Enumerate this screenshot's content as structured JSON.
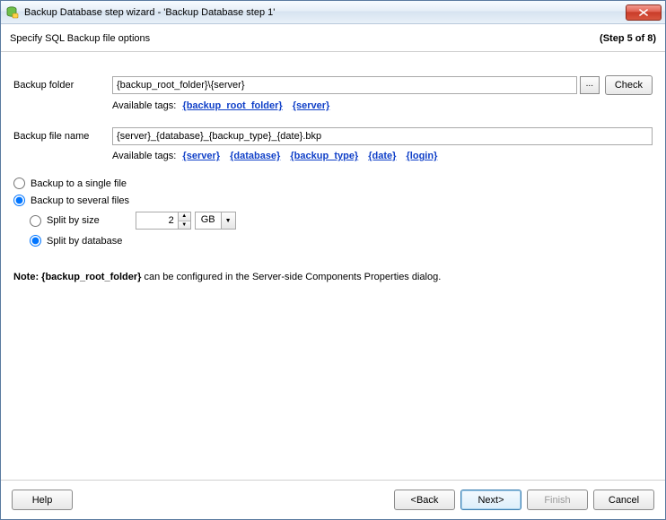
{
  "window": {
    "title": "Backup Database step wizard - 'Backup Database step 1'"
  },
  "header": {
    "subtitle": "Specify SQL Backup file options",
    "step_indicator": "(Step 5 of 8)"
  },
  "folder": {
    "label": "Backup folder",
    "value": "{backup_root_folder}\\{server}",
    "browse": "...",
    "check": "Check",
    "tags_label": "Available tags:",
    "tags": [
      "{backup_root_folder}",
      "{server}"
    ]
  },
  "filename": {
    "label": "Backup file name",
    "value": "{server}_{database}_{backup_type}_{date}.bkp",
    "tags_label": "Available tags:",
    "tags": [
      "{server}",
      "{database}",
      "{backup_type}",
      "{date}",
      "{login}"
    ]
  },
  "options": {
    "single": "Backup to a single file",
    "several": "Backup to several files",
    "split_size": "Split by size",
    "split_db": "Split by database",
    "size_value": "2",
    "unit": "GB",
    "selected_main": "several",
    "selected_sub": "split_db"
  },
  "note": {
    "prefix": "Note:  ",
    "bold": "{backup_root_folder}",
    "suffix": " can be configured in the Server-side Components Properties dialog."
  },
  "footer": {
    "help": "Help",
    "back": "<Back",
    "next": "Next>",
    "finish": "Finish",
    "cancel": "Cancel"
  }
}
